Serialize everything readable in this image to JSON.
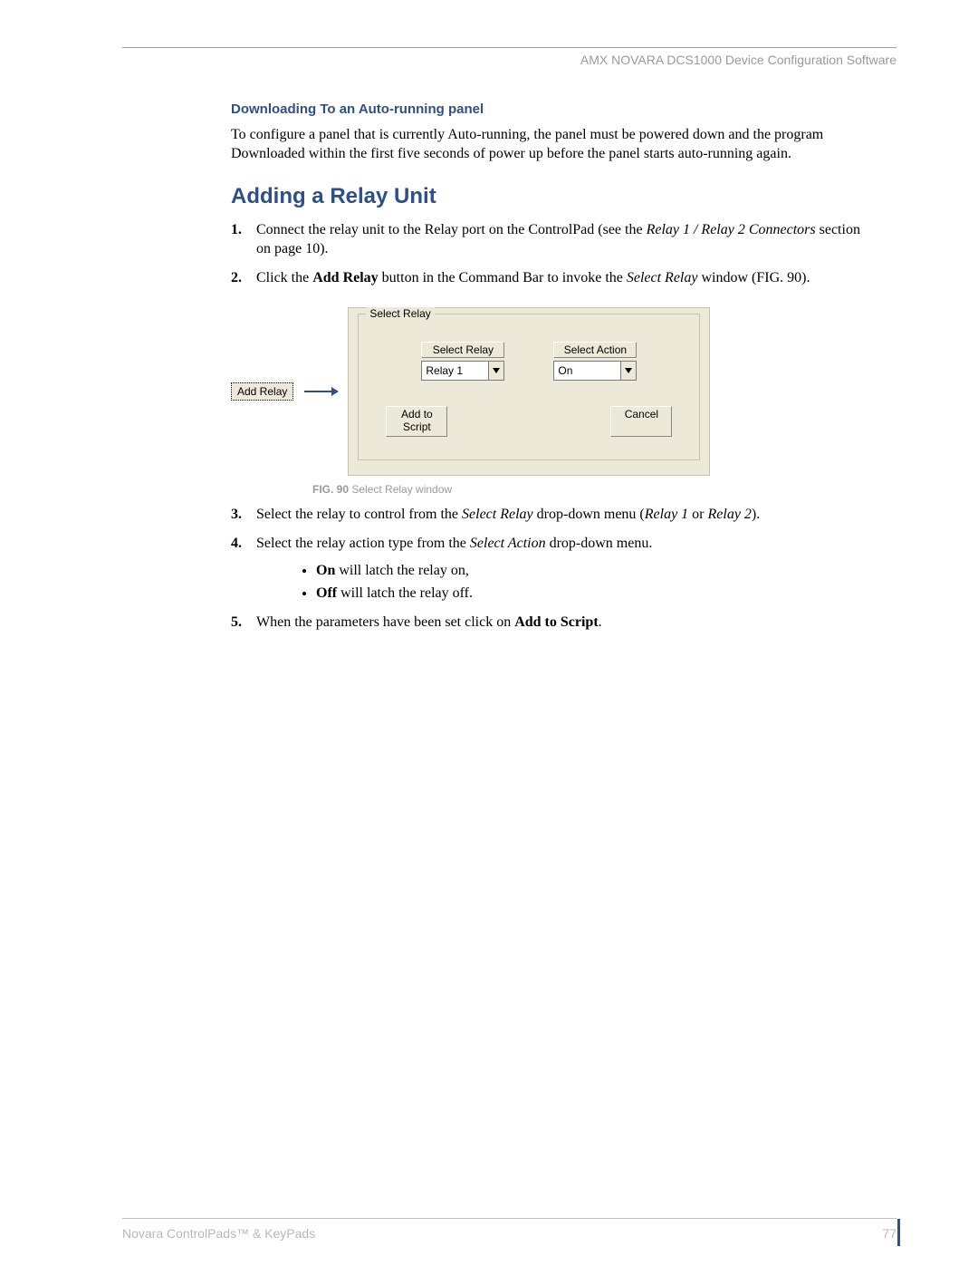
{
  "header": {
    "running_title": "AMX NOVARA DCS1000 Device Configuration Software"
  },
  "section1": {
    "title": "Downloading To an Auto-running panel",
    "para": "To configure a panel that is currently Auto-running, the panel must be powered down and the program Downloaded within the first five seconds of power up before the panel starts auto-running again."
  },
  "section2": {
    "title": "Adding a Relay Unit",
    "step1_pre": "Connect the relay unit to the Relay port on the ControlPad (see the ",
    "step1_em": "Relay 1 / Relay 2 Connectors",
    "step1_post": " section on page 10).",
    "step2_pre": "Click the ",
    "step2_bold": "Add Relay",
    "step2_mid": " button in the Command Bar to invoke the ",
    "step2_em": "Select Relay",
    "step2_post": " window (FIG. 90).",
    "step3_pre": "Select the relay to control from the ",
    "step3_em1": "Select Relay",
    "step3_mid": " drop-down menu (",
    "step3_em2": "Relay 1",
    "step3_or": " or ",
    "step3_em3": "Relay 2",
    "step3_post": ").",
    "step4_pre": "Select the relay action type from the ",
    "step4_em": "Select Action",
    "step4_post": " drop-down menu.",
    "bullet_on_b": "On",
    "bullet_on_t": " will latch the relay on,",
    "bullet_off_b": "Off",
    "bullet_off_t": " will latch the relay off.",
    "step5_pre": "When the parameters have been set click on ",
    "step5_bold": "Add to Script",
    "step5_post": "."
  },
  "figure": {
    "add_relay_button": "Add Relay",
    "panel_title": "Select Relay",
    "label_select_relay": "Select Relay",
    "label_select_action": "Select Action",
    "value_relay": "Relay 1",
    "value_action": "On",
    "btn_add_to_script": "Add to\nScript",
    "btn_cancel": "Cancel",
    "caption_bold": "FIG. 90",
    "caption_rest": "  Select Relay window"
  },
  "footer": {
    "left": "Novara ControlPads™ & KeyPads",
    "page": "77"
  }
}
